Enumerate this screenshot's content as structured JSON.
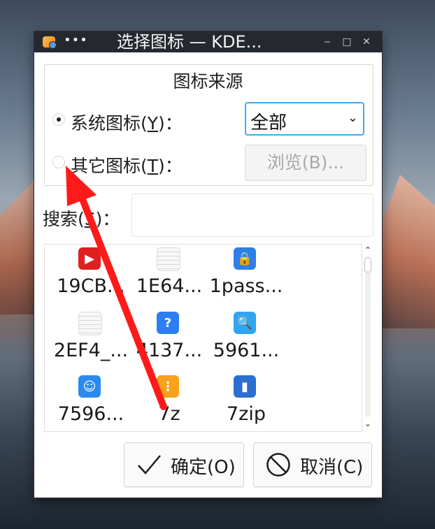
{
  "window": {
    "title": "选择图标 — KDE...",
    "menu_dots": "•••",
    "controls": {
      "minimize": "‒",
      "maximize": "□",
      "close": "✕"
    }
  },
  "icon_source": {
    "group_title": "图标来源",
    "system_option": {
      "label_pre": "系统图标(",
      "mnemonic": "Y",
      "label_post": ")：",
      "selected": true
    },
    "other_option": {
      "label_pre": "其它图标(",
      "mnemonic": "T",
      "label_post": ")：",
      "selected": false
    },
    "category_select": {
      "value": "全部",
      "arrow": "⌄"
    },
    "browse_button": {
      "label": "浏览(B)...",
      "enabled": false
    }
  },
  "search": {
    "label_pre": "搜索(",
    "mnemonic": "S",
    "label_post": ")：",
    "value": ""
  },
  "icons": [
    {
      "name": "19CB...",
      "icon": "video-app-icon",
      "color": "#e02020",
      "glyph": "▶"
    },
    {
      "name": "1E64...",
      "icon": "text-document-icon",
      "color": "#f1f1f1",
      "glyph": ""
    },
    {
      "name": "1pass...",
      "icon": "password-lock-icon",
      "color": "#2f7fe8",
      "glyph": "🔒"
    },
    {
      "name": "2EF4_...",
      "icon": "text-document-icon",
      "color": "#f1f1f1",
      "glyph": ""
    },
    {
      "name": "4137...",
      "icon": "help-question-icon",
      "color": "#2d7ff0",
      "glyph": "?"
    },
    {
      "name": "5961...",
      "icon": "search-magnifier-icon",
      "color": "#2ea6f2",
      "glyph": "🔍"
    },
    {
      "name": "7596...",
      "icon": "avatar-badge-icon",
      "color": "#2b8af0",
      "glyph": "☺"
    },
    {
      "name": "7z",
      "icon": "archive-7z-icon",
      "color": "#f7a21a",
      "glyph": "⋮"
    },
    {
      "name": "7zip",
      "icon": "zip-archive-icon",
      "color": "#2b6fcf",
      "glyph": "▮"
    }
  ],
  "buttons": {
    "ok": {
      "label": "确定(O)"
    },
    "cancel": {
      "label": "取消(C)"
    }
  },
  "annotation_arrow": {
    "color": "#ff1a1a"
  }
}
